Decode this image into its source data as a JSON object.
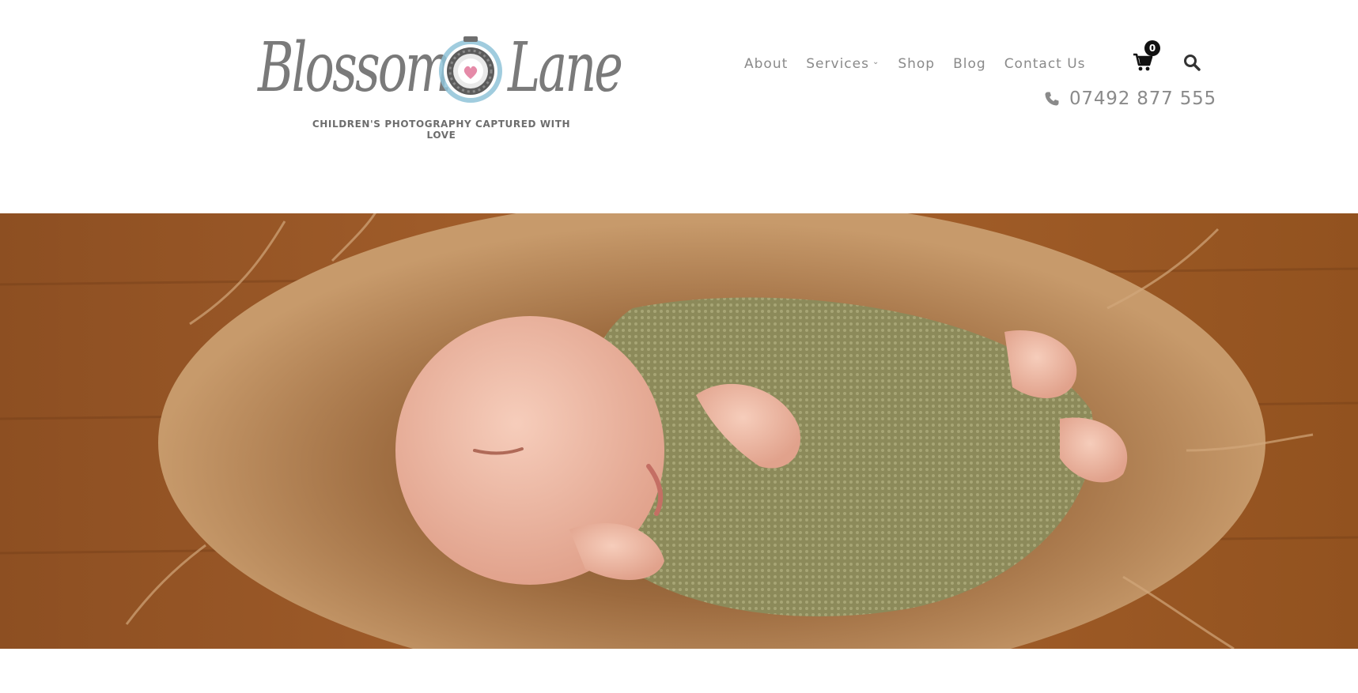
{
  "logo": {
    "word_left": "Blossom",
    "word_right": "Lane",
    "tagline": "CHILDREN'S PHOTOGRAPHY CAPTURED WITH LOVE",
    "badge_icon": "camera-heart-icon"
  },
  "nav": {
    "items": [
      {
        "label": "About"
      },
      {
        "label": "Services",
        "has_dropdown": true
      },
      {
        "label": "Shop"
      },
      {
        "label": "Blog"
      },
      {
        "label": "Contact Us"
      }
    ]
  },
  "cart": {
    "icon": "cart-icon",
    "count": "0"
  },
  "search": {
    "icon": "search-icon"
  },
  "contact": {
    "phone_icon": "phone-icon",
    "phone": "07492 877 555"
  },
  "hero": {
    "image": "newborn-baby-sleeping-on-fur-photo"
  },
  "colors": {
    "text_gray": "#8a8a8a",
    "badge_black": "#111111",
    "logo_blue": "#8fc3d8",
    "logo_heart": "#e58aa8"
  }
}
